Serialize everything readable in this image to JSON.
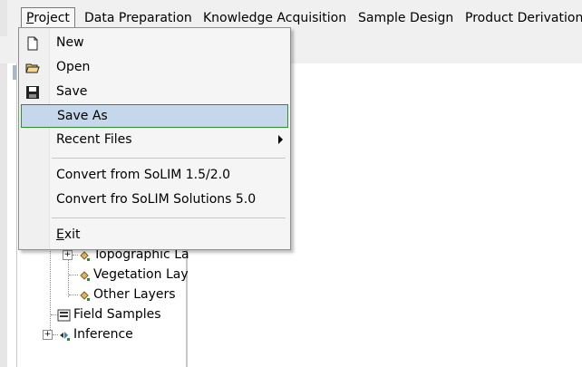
{
  "menubar": {
    "items": [
      "Project",
      "Data Preparation",
      "Knowledge Acquisition",
      "Sample Design",
      "Product Derivation"
    ]
  },
  "dropdown": {
    "new": "New",
    "open": "Open",
    "save": "Save",
    "save_as": "Save As",
    "recent_files": "Recent Files",
    "convert_solim": "Convert from SoLIM 1.5/2.0",
    "convert_solutions": "Convert fro SoLIM Solutions 5.0",
    "exit": "Exit"
  },
  "tree": {
    "topographic": "Topographic La",
    "vegetation": "Vegetation Lay",
    "other": "Other Layers",
    "field_samples": "Field Samples",
    "inference": "Inference"
  },
  "colors": {
    "menu_highlight": "#c5d7ea",
    "highlight_border": "#2f8f2f",
    "menu_bg": "#f5f5f5"
  }
}
